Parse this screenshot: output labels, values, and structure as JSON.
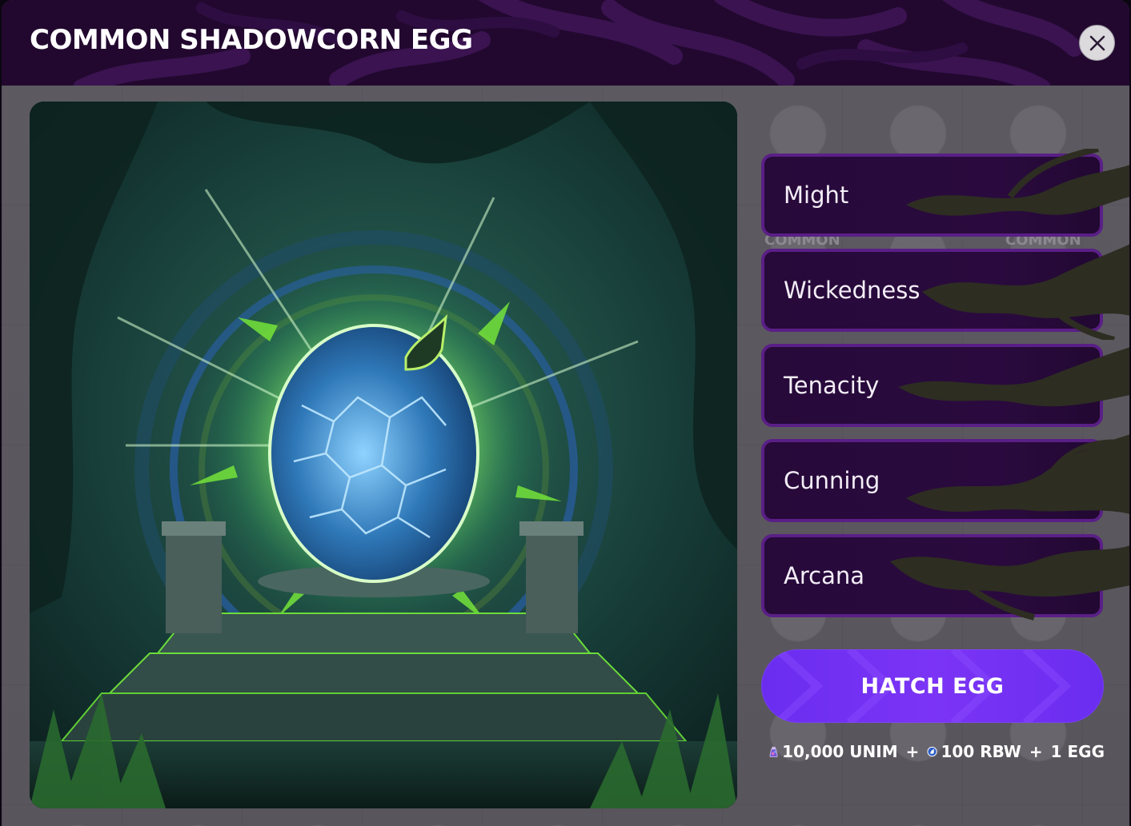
{
  "modal": {
    "title": "COMMON SHADOWCORN EGG",
    "close_icon": "close-icon"
  },
  "rarity_watermark": [
    "COMMON",
    "COMMON"
  ],
  "stats": [
    {
      "label": "Might"
    },
    {
      "label": "Wickedness"
    },
    {
      "label": "Tenacity"
    },
    {
      "label": "Cunning"
    },
    {
      "label": "Arcana"
    }
  ],
  "hatch_button": {
    "label": "HATCH EGG"
  },
  "cost": {
    "unim": "10,000 UNIM",
    "plus1": "+",
    "rbw": "100 RBW",
    "plus2": "+",
    "egg": "1 EGG",
    "unim_icon": "unim-potion-icon",
    "rbw_icon": "rbw-unicorn-icon"
  },
  "colors": {
    "header_bg": "#22082f",
    "stat_bg": "#27093a",
    "stat_border": "#5a1f86",
    "button": "#6a2df0"
  }
}
